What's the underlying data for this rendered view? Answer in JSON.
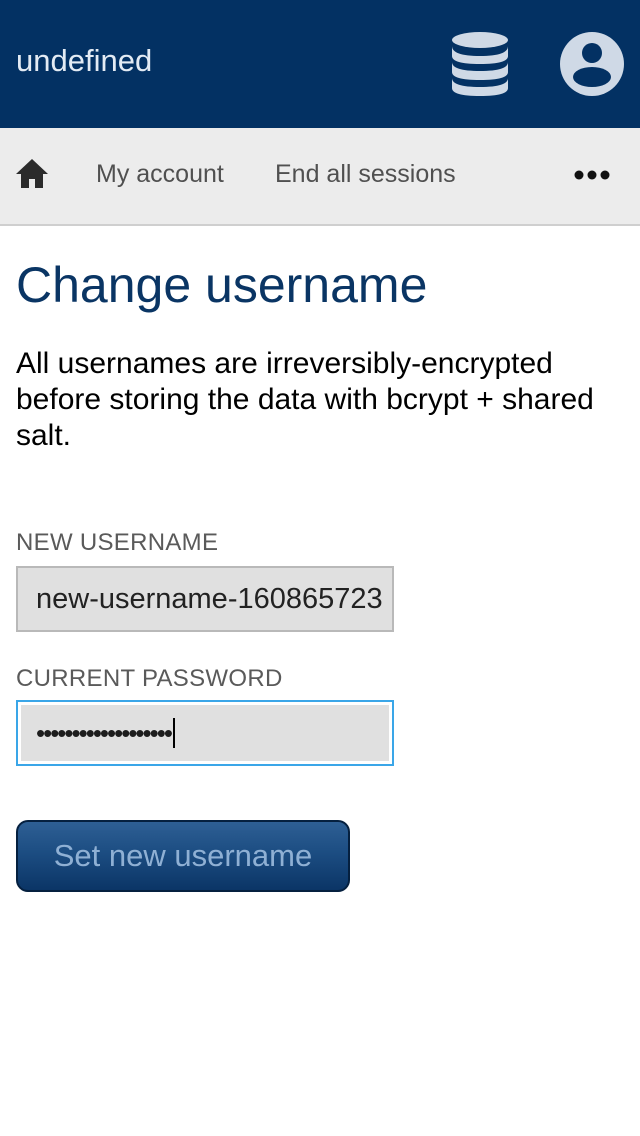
{
  "header": {
    "title": "undefined",
    "db_icon": "database-icon",
    "account_icon": "account-circle-icon"
  },
  "nav": {
    "home_icon": "home-icon",
    "items": [
      {
        "label": "My account"
      },
      {
        "label": "End all sessions"
      }
    ],
    "more_icon": "more-horizontal-icon"
  },
  "main": {
    "title": "Change username",
    "description": "All usernames are irreversibly-encrypted before storing the data with bcrypt + shared salt."
  },
  "form": {
    "username_label": "NEW USERNAME",
    "username_value": "new-username-160865723",
    "password_label": "CURRENT PASSWORD",
    "password_value": "•••••••••••••••••••",
    "submit_label": "Set new username"
  },
  "colors": {
    "header_bg": "#033163",
    "title": "#0a3564",
    "focus_border": "#3aa6e8"
  }
}
